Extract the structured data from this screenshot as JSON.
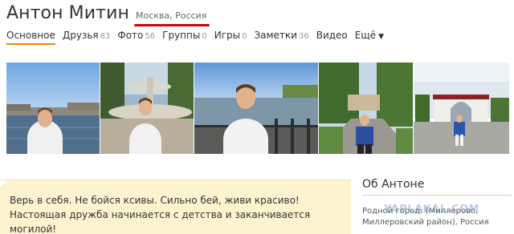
{
  "profile": {
    "name": "Антон Митин",
    "location": "Москва, Россия"
  },
  "nav": [
    {
      "label": "Основное",
      "count": "",
      "active": true
    },
    {
      "label": "Друзья",
      "count": "83"
    },
    {
      "label": "Фото",
      "count": "56"
    },
    {
      "label": "Группы",
      "count": "0"
    },
    {
      "label": "Игры",
      "count": "0"
    },
    {
      "label": "Заметки",
      "count": "36"
    },
    {
      "label": "Видео",
      "count": ""
    },
    {
      "label": "Ещё",
      "count": ""
    }
  ],
  "nav_more_icon": "chevron-down-icon",
  "status": {
    "text": "Верь в себя. Не бойся ксивы. Сильно бей, живи красиво!Настоящая дружба начинается с детства и заканчивается могилой!"
  },
  "about": {
    "title": "Об Антоне",
    "hometown": "Родной город: (Миллерово, Миллеровский район), Россия"
  },
  "watermark": "YAPLAKAL.COM",
  "colors": {
    "accent_underline": "#ee8208",
    "highlight_mark": "#d40000",
    "status_background": "#fdf3cf"
  }
}
